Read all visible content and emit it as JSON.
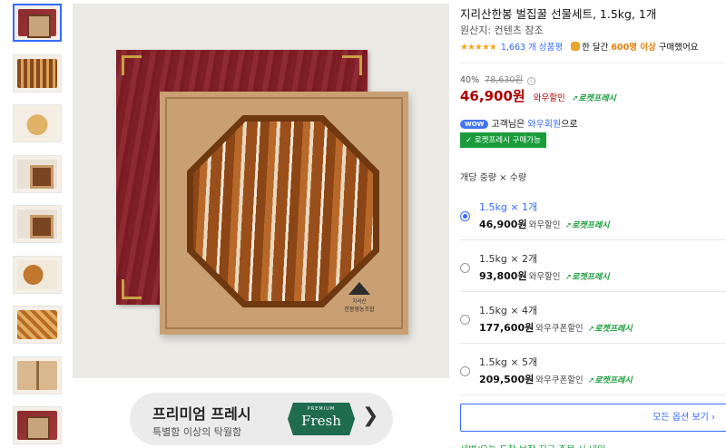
{
  "thumbnails": [
    {
      "name": "thumb-box-closed"
    },
    {
      "name": "thumb-honey-comb-box"
    },
    {
      "name": "thumb-honey-plate"
    },
    {
      "name": "thumb-kraft-box"
    },
    {
      "name": "thumb-kraft-box-open"
    },
    {
      "name": "thumb-food-dish"
    },
    {
      "name": "thumb-waffle"
    },
    {
      "name": "thumb-gift-wrap"
    },
    {
      "name": "thumb-box-small"
    }
  ],
  "main_image": {
    "brand_sub": "지리산",
    "brand_name": "한봉영농조합"
  },
  "banner": {
    "title": "프리미엄 프레시",
    "subtitle": "특별함 이상의 탁월함",
    "badge_small": "PREMIUM",
    "badge_word": "Fresh",
    "chevron": "❯"
  },
  "product": {
    "title": "지리산한봉 벌집꿀 선물세트, 1.5kg, 1개",
    "origin": "원산지: 컨텐츠 참조",
    "stars": "★★★★★",
    "review_count": "1,663 개 상품평",
    "buyers_pre": "한 달간 ",
    "buyers_count": "600명 이상",
    "buyers_post": " 구매했어요",
    "discount": "40%",
    "original_price": "78,630원",
    "info": "i",
    "price": "46,900원",
    "price_tag": "와우할인",
    "rocket_label": "로켓프레시",
    "wow_badge": "WOW",
    "wow_pre": "고객님은 ",
    "wow_link": "와우회원",
    "wow_post": "으로",
    "rocket_pill": "✓ 로켓프레시 구매가능",
    "option_label": "개당 중량 × 수량",
    "all_options": "모든 옵션 보기 ›",
    "bottom_cut": "새벽/오늘 도착 보장 지금 주문 시 내일"
  },
  "options": [
    {
      "name": "1.5kg × 1개",
      "price": "46,900원",
      "tag": "와우할인",
      "rocket": "로켓프레시",
      "selected": true
    },
    {
      "name": "1.5kg × 2개",
      "price": "93,800원",
      "tag": "와우할인",
      "rocket": "로켓프레시",
      "selected": false
    },
    {
      "name": "1.5kg × 4개",
      "price": "177,600원",
      "tag": "와우쿠폰할인",
      "rocket": "로켓프레시",
      "selected": false
    },
    {
      "name": "1.5kg × 5개",
      "price": "209,500원",
      "tag": "와우쿠폰할인",
      "rocket": "로켓프레시",
      "selected": false
    }
  ],
  "colors": {
    "accent": "#346aff",
    "price_red": "#ae0000",
    "rocket_green": "#1a9c3b",
    "star": "#f5a623"
  },
  "icons": {
    "rocket": "rocket-icon",
    "chevron": "chevron-right-icon",
    "info": "info-icon"
  }
}
